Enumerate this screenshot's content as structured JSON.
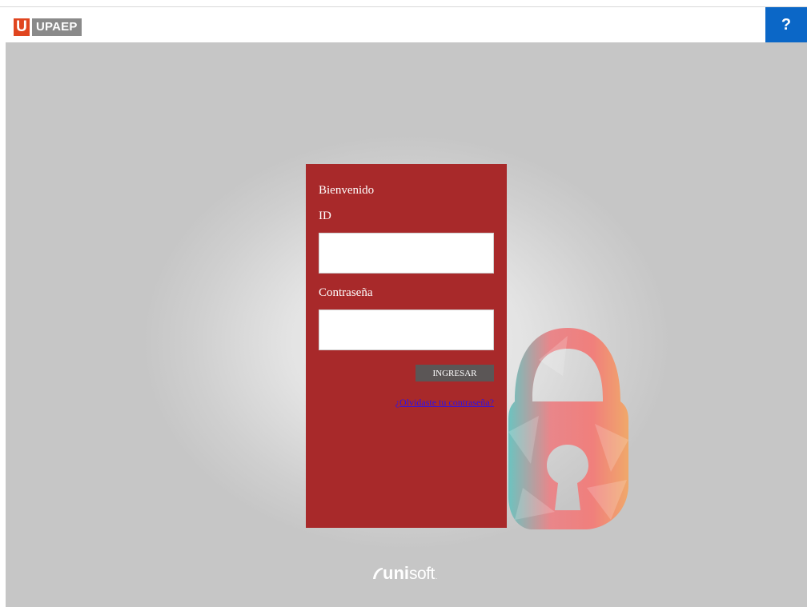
{
  "header": {
    "logo_letter": "U",
    "logo_name": "UPAEP",
    "help_label": "?"
  },
  "login": {
    "welcome": "Bienvenido",
    "id_label": "ID",
    "id_value": "",
    "password_label": "Contraseña",
    "password_value": "",
    "submit_label": "INGRESAR",
    "forgot_link": "¿Olvidaste tu contraseña?"
  },
  "footer": {
    "brand_bold": "uni",
    "brand_light": "soft",
    "brand_dot": "."
  },
  "colors": {
    "panel": "#a8292a",
    "help_button": "#0b67c7",
    "logo_accent": "#e0451f",
    "submit_button": "#5b5656",
    "link": "#2c12e8"
  },
  "icons": [
    "lock-illustration",
    "unisoft-swoosh-icon"
  ]
}
